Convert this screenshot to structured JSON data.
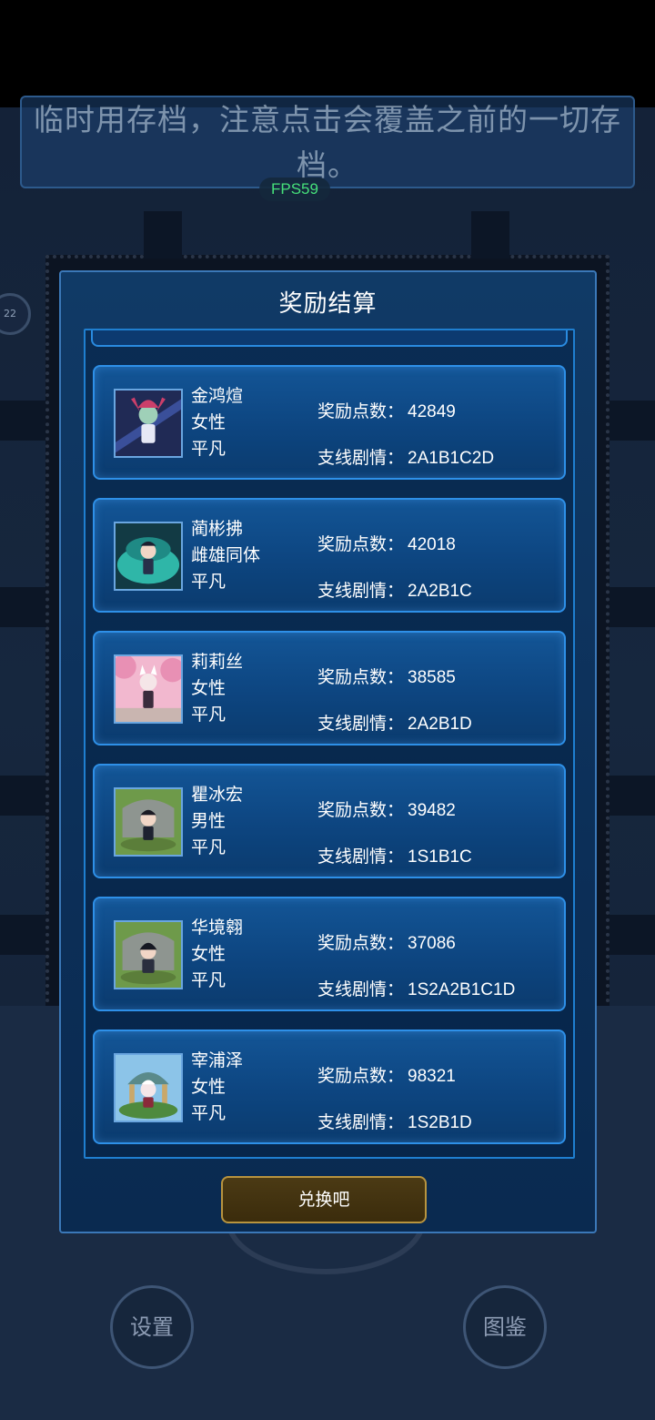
{
  "notice_text": "临时用存档，注意点击会覆盖之前的一切存档。",
  "fps_label": "FPS59",
  "side_badge": "22",
  "modal": {
    "title": "奖励结算",
    "reward_label": "奖励点数：",
    "branch_label": "支线剧情：",
    "exchange_button": "兑换吧"
  },
  "characters": [
    {
      "name": "金鸿煊",
      "gender": "女性",
      "rank": "平凡",
      "reward_points": "42849",
      "branch_story": "2A1B1C2D",
      "avatar_icon": "character-portrait-icon"
    },
    {
      "name": "蔺彬拂",
      "gender": "雌雄同体",
      "rank": "平凡",
      "reward_points": "42018",
      "branch_story": "2A2B1C",
      "avatar_icon": "character-portrait-icon"
    },
    {
      "name": "莉莉丝",
      "gender": "女性",
      "rank": "平凡",
      "reward_points": "38585",
      "branch_story": "2A2B1D",
      "avatar_icon": "character-portrait-icon"
    },
    {
      "name": "瞿冰宏",
      "gender": "男性",
      "rank": "平凡",
      "reward_points": "39482",
      "branch_story": "1S1B1C",
      "avatar_icon": "character-portrait-icon"
    },
    {
      "name": "华境翱",
      "gender": "女性",
      "rank": "平凡",
      "reward_points": "37086",
      "branch_story": "1S2A2B1C1D",
      "avatar_icon": "character-portrait-icon"
    },
    {
      "name": "宰浦泽",
      "gender": "女性",
      "rank": "平凡",
      "reward_points": "98321",
      "branch_story": "1S2B1D",
      "avatar_icon": "character-portrait-icon"
    }
  ],
  "bottom_buttons": {
    "settings": "设置",
    "codex": "图鉴"
  },
  "colors": {
    "panel": "#0c2f58",
    "card": "#0d4580",
    "card_border": "#2e90e8",
    "button_gold": "#b8943f",
    "fps_green": "#46e07a"
  }
}
